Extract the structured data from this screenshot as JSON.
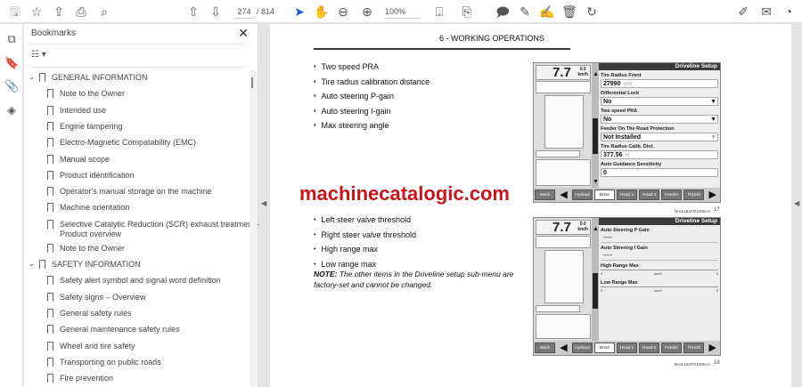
{
  "toolbar": {
    "page_current": "274",
    "page_total": "/ 814",
    "zoom": "100%",
    "icons": [
      "save-icon",
      "bookmark-star-icon",
      "upload-icon",
      "print-icon",
      "search-icon",
      "page-up-icon",
      "page-down-icon",
      "select-cursor-icon",
      "hand-icon",
      "zoom-out-icon",
      "zoom-in-icon",
      "page-fit-icon",
      "scroll-mode-icon",
      "comment-icon",
      "pen-icon",
      "sign-icon",
      "delete-icon",
      "rotate-icon",
      "share-icon",
      "email-icon",
      "account-icon"
    ]
  },
  "sidebar": {
    "title": "Bookmarks",
    "items": [
      {
        "label": "GENERAL INFORMATION",
        "level": 0,
        "expanded": true
      },
      {
        "label": "Note to the Owner",
        "level": 1
      },
      {
        "label": "Intended use",
        "level": 1
      },
      {
        "label": "Engine tampering",
        "level": 1
      },
      {
        "label": "Electro-Magnetic Compatability (EMC)",
        "level": 1
      },
      {
        "label": "Manual scope",
        "level": 1
      },
      {
        "label": "Product identification",
        "level": 1
      },
      {
        "label": "Operator's manual storage on the machine",
        "level": 1
      },
      {
        "label": "Machine orientation",
        "level": 1
      },
      {
        "label": "Selective Catalytic Reduction (SCR) exhaust treatment -",
        "label2": "Product overview",
        "level": 1
      },
      {
        "label": "Note to the Owner",
        "level": 1
      },
      {
        "label": "SAFETY INFORMATION",
        "level": 0,
        "expanded": true
      },
      {
        "label": "Safety alert symbol and signal word definition",
        "level": 1
      },
      {
        "label": "Safety signs  – Overview",
        "level": 1
      },
      {
        "label": "General safety rules",
        "level": 1
      },
      {
        "label": "General maintenance safety rules",
        "level": 1
      },
      {
        "label": "Wheel and tire safety",
        "level": 1
      },
      {
        "label": "Transporting on public roads",
        "level": 1
      },
      {
        "label": "Fire prevention",
        "level": 1
      }
    ]
  },
  "page": {
    "header": "6 - WORKING OPERATIONS",
    "bullets1": [
      "Two speed PRA",
      "Tire radius calibration distance",
      "Auto steering P-gain",
      "Auto steering I-gain",
      "Max steering angle"
    ],
    "watermark": "machinecatalogic.com",
    "bullets2": [
      "Left steer valve threshold",
      "Right steer valve threshold",
      "High range max",
      "Low range max"
    ],
    "note_label": "NOTE:",
    "note_text": " The other items in the Driveline setup sub-menu are factory-set and cannot be changed.",
    "screens": [
      {
        "speed": "7.7",
        "speed_small": "0.0",
        "speed_unit": "km/h",
        "title": "Driveline Setup",
        "fields": [
          {
            "label": "Tire Radius Front",
            "value": "27990",
            "unit": "mm"
          },
          {
            "label": "Differential Lock",
            "value": "No",
            "dropdown": true
          },
          {
            "label": "Two speed PRA",
            "value": "No",
            "dropdown": true
          },
          {
            "label": "Feeder On The Road Protection",
            "value": "Not Installed",
            "dropdown": true
          },
          {
            "label": "Tire Radius Calib. Dist.",
            "value": "377.56",
            "unit": "m"
          },
          {
            "label": "Auto Guidance Sensitivity",
            "value": "0"
          }
        ],
        "caption": "NHIL16AFD1095AA",
        "num": "17"
      },
      {
        "speed": "7.7",
        "speed_small": "0.0",
        "speed_unit": "km/h",
        "title": "Driveline Setup",
        "fields": [
          {
            "label": "Auto Steering P Gain",
            "value": "------"
          },
          {
            "label": "Auto Steering I Gain",
            "value": "------"
          },
          {
            "label": "High Range Max",
            "range": [
              "0",
              "km/h",
              "0"
            ]
          },
          {
            "label": "Low Range Max",
            "range": [
              "0",
              "km/h",
              "0"
            ]
          }
        ],
        "caption": "NHIL16AFD1096AA",
        "num": "18"
      }
    ],
    "tabs": [
      "Back",
      "Hydraul",
      "Drive",
      "Head 1",
      "Head 2",
      "Feeder",
      "Thresh"
    ]
  }
}
